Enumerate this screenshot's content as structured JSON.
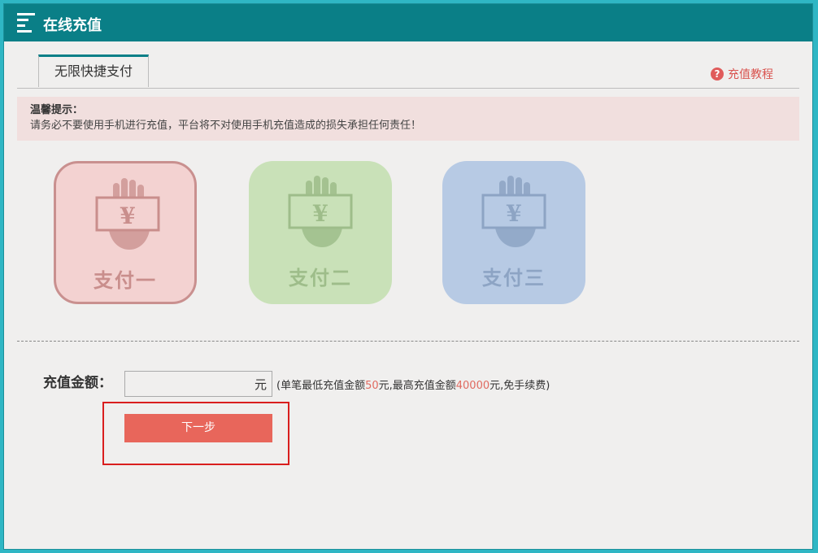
{
  "header": {
    "title": "在线充值",
    "menu_icon": "menu-icon"
  },
  "tabs": [
    {
      "label": "无限快捷支付",
      "active": true
    }
  ],
  "help": {
    "label": "充值教程",
    "icon": "question-icon",
    "icon_glyph": "?"
  },
  "notice": {
    "title": "温馨提示：",
    "text": "请务必不要使用手机进行充值，平台将不对使用手机充值造成的损失承担任何责任！"
  },
  "payment_methods": [
    {
      "label": "支付一",
      "selected": true,
      "color": "#f3d2d1"
    },
    {
      "label": "支付二",
      "selected": false,
      "color": "#c9e1b8"
    },
    {
      "label": "支付三",
      "selected": false,
      "color": "#b7cae4"
    }
  ],
  "amount": {
    "label": "充值金额：",
    "value": "",
    "unit": "元",
    "hint_prefix": "(单笔最低充值金额",
    "min": "50",
    "hint_mid": "元,最高充值金额",
    "max": "40000",
    "hint_suffix": "元,免手续费)"
  },
  "next_button": {
    "label": "下一步"
  },
  "colors": {
    "header": "#0a7f87",
    "accent": "#e8665b",
    "highlight_border": "#d91e1e"
  }
}
